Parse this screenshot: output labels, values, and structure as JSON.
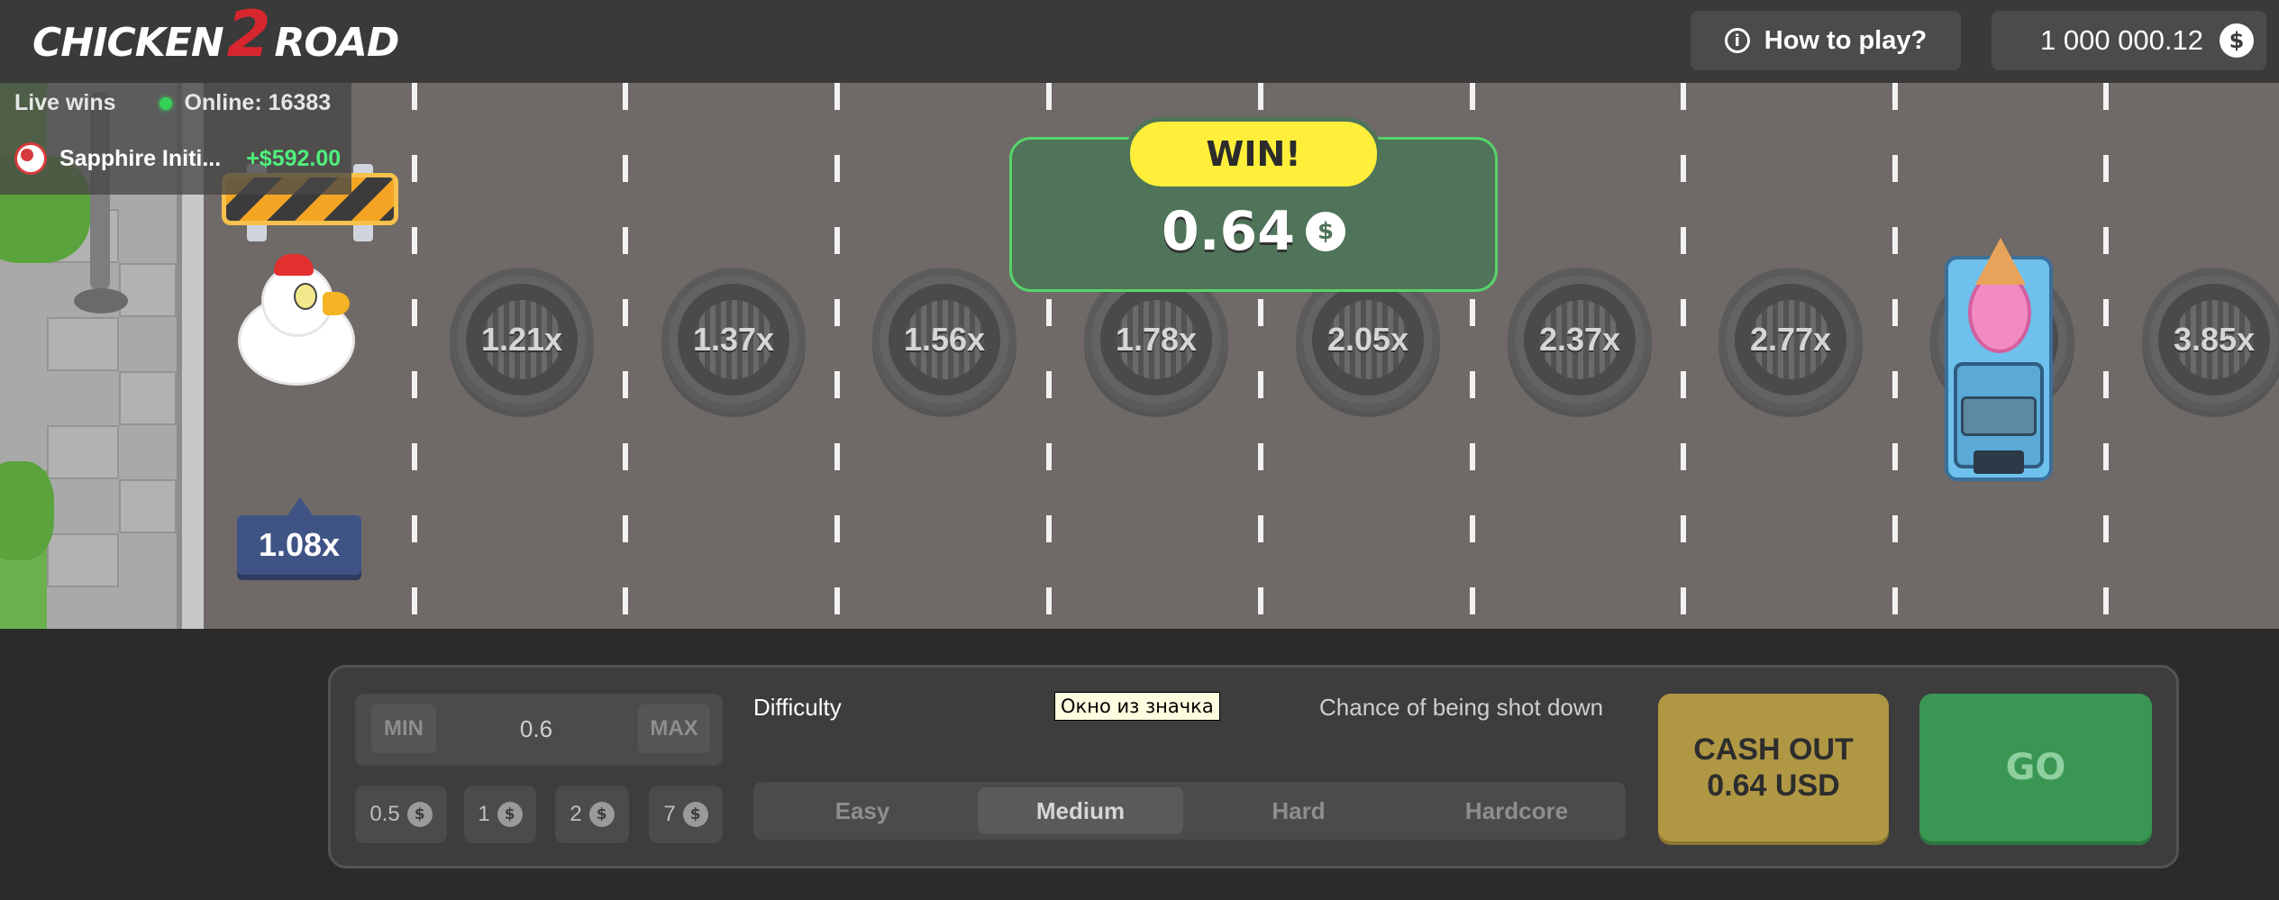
{
  "header": {
    "logo_left": "CHICKEN",
    "logo_num": "2",
    "logo_right": "ROAD",
    "how_to_play": "How to play?",
    "info_glyph": "i",
    "balance": "1 000 000.12",
    "currency_glyph": "$"
  },
  "live": {
    "label": "Live wins",
    "online": "Online: 16383",
    "player_name": "Sapphire Initi...",
    "player_win": "+$592.00"
  },
  "game": {
    "current_multiplier": "1.08x",
    "lanes": [
      "1.21x",
      "1.37x",
      "1.56x",
      "1.78x",
      "2.05x",
      "2.37x",
      "2.77x",
      "",
      "3.85x"
    ],
    "win_label": "WIN!",
    "win_amount": "0.64",
    "currency_glyph": "$"
  },
  "bet": {
    "min_label": "MIN",
    "max_label": "MAX",
    "value": "0.6",
    "chips": [
      "0.5",
      "1",
      "2",
      "7"
    ],
    "chip_glyph": "$"
  },
  "difficulty": {
    "label": "Difficulty",
    "tooltip": "Окно из значка",
    "chance_label": "Chance of being shot down",
    "options": [
      "Easy",
      "Medium",
      "Hard",
      "Hardcore"
    ],
    "selected": "Medium"
  },
  "actions": {
    "cashout_line1": "CASH OUT",
    "cashout_line2": "0.64 USD",
    "go": "GO"
  },
  "icons": {
    "info": "info-icon",
    "coin": "coin-icon",
    "flag": "flag-icon"
  },
  "colors": {
    "header_bg": "#3a3a3a",
    "road": "#6f6a67",
    "win_bg": "#4f7459",
    "win_label_bg": "#ffef3a",
    "cashout_bg": "#b09744",
    "go_bg": "#3a9753",
    "online_green": "#34d058"
  }
}
